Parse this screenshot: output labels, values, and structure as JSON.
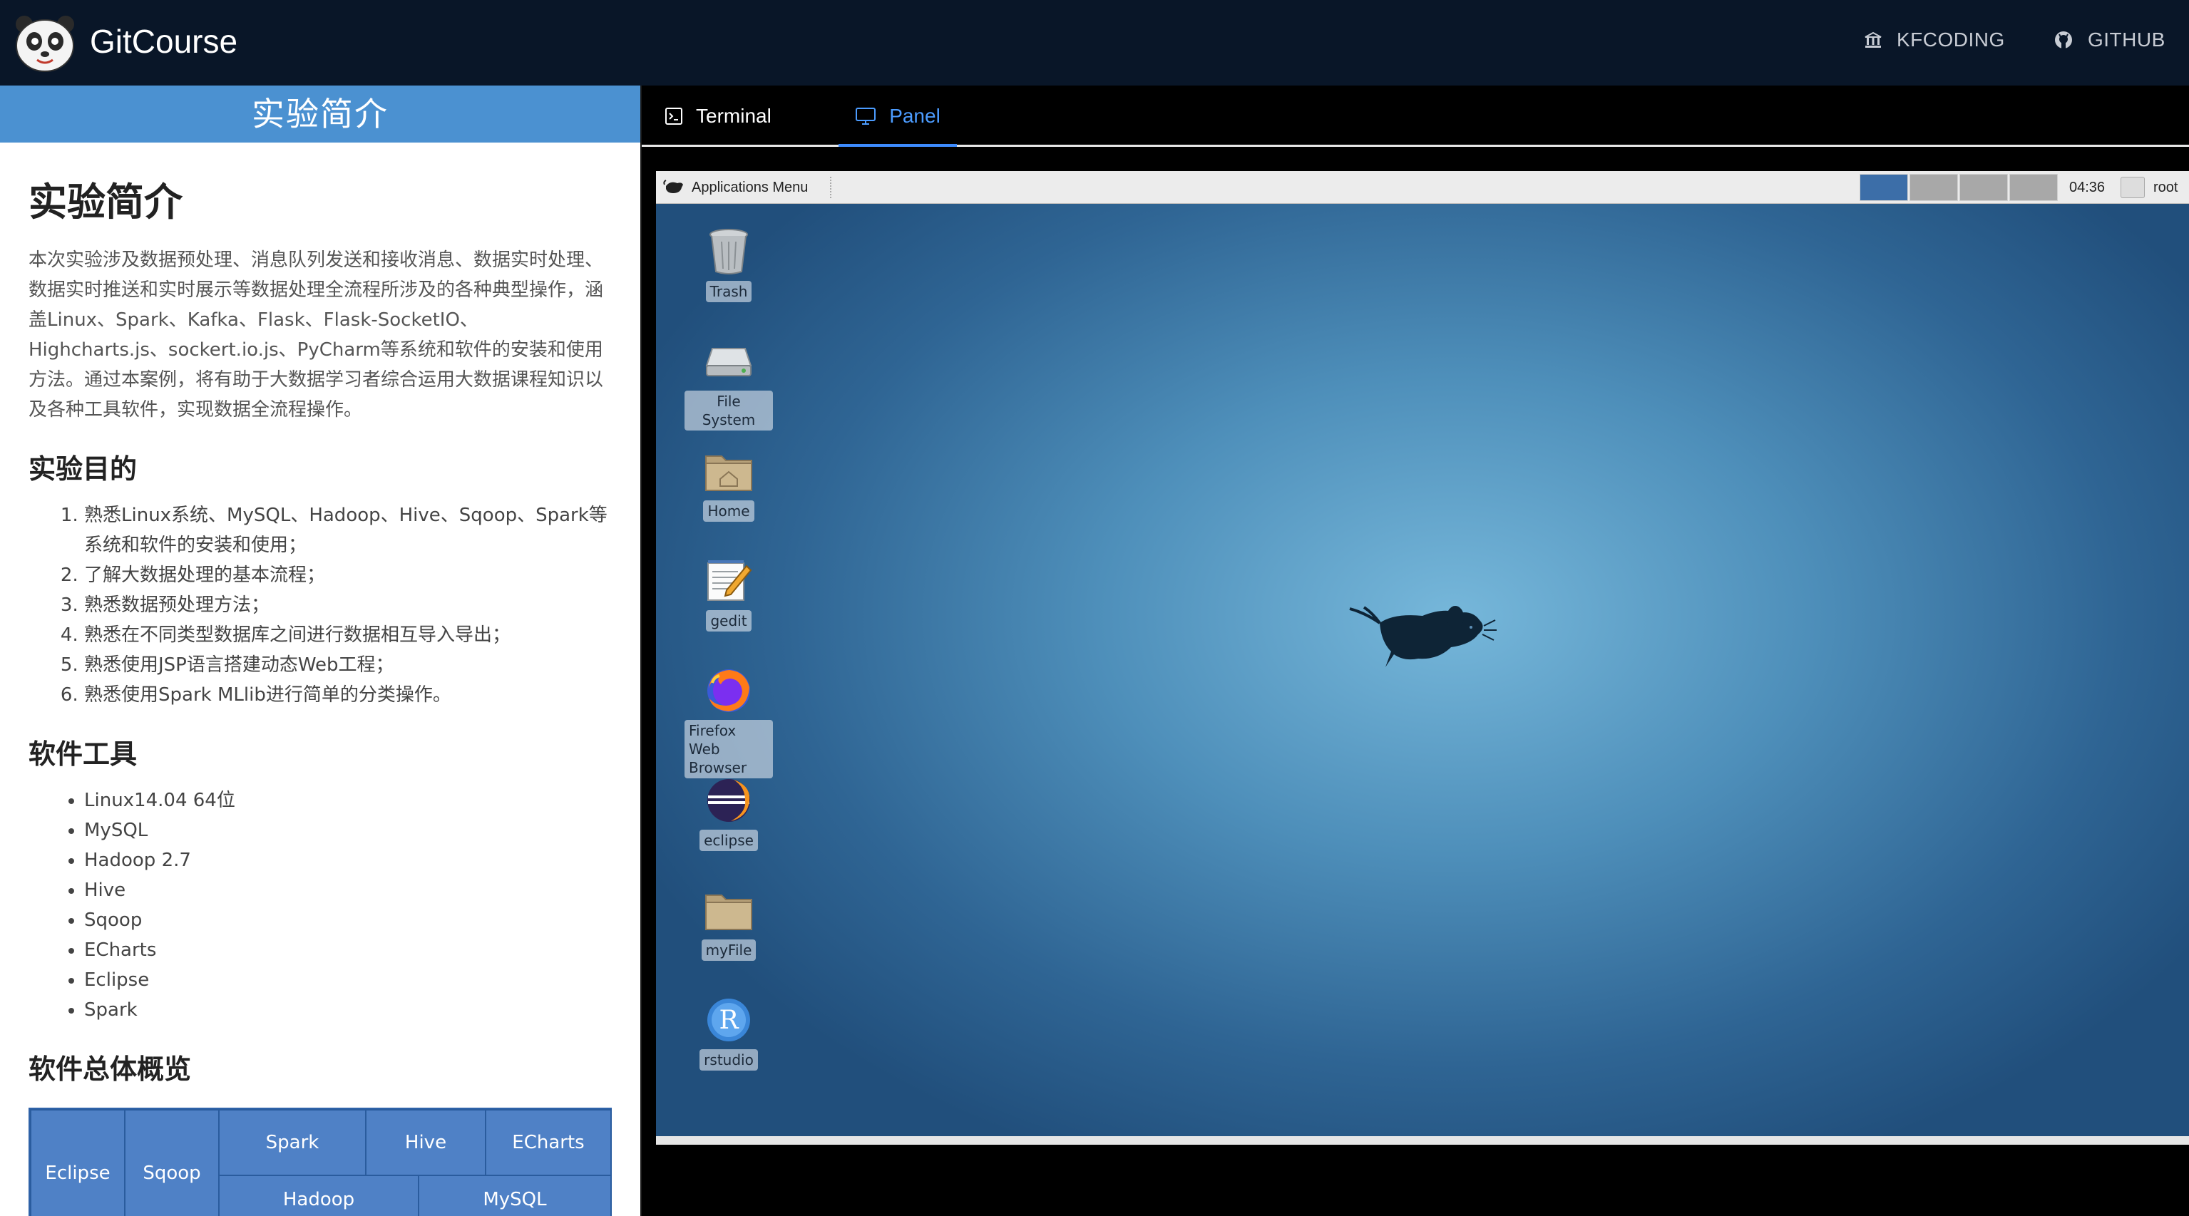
{
  "topbar": {
    "brand": "GitCourse",
    "links": [
      {
        "label": "KFCODING",
        "icon": "bank-icon"
      },
      {
        "label": "GITHUB",
        "icon": "github-icon"
      }
    ]
  },
  "doc": {
    "header": "实验简介",
    "title": "实验简介",
    "intro": "本次实验涉及数据预处理、消息队列发送和接收消息、数据实时处理、数据实时推送和实时展示等数据处理全流程所涉及的各种典型操作，涵盖Linux、Spark、Kafka、Flask、Flask-SocketIO、Highcharts.js、sockert.io.js、PyCharm等系统和软件的安装和使用方法。通过本案例，将有助于大数据学习者综合运用大数据课程知识以及各种工具软件，实现数据全流程操作。",
    "goals_title": "实验目的",
    "goals": [
      "熟悉Linux系统、MySQL、Hadoop、Hive、Sqoop、Spark等系统和软件的安装和使用；",
      "了解大数据处理的基本流程；",
      "熟悉数据预处理方法；",
      "熟悉在不同类型数据库之间进行数据相互导入导出；",
      "熟悉使用JSP语言搭建动态Web工程；",
      "熟悉使用Spark MLlib进行简单的分类操作。"
    ],
    "tools_title": "软件工具",
    "tools": [
      "Linux14.04 64位",
      "MySQL",
      "Hadoop 2.7",
      "Hive",
      "Sqoop",
      "ECharts",
      "Eclipse",
      "Spark"
    ],
    "overview_title": "软件总体概览",
    "arch": {
      "eclipse": "Eclipse",
      "sqoop": "Sqoop",
      "spark": "Spark",
      "hive": "Hive",
      "echarts": "ECharts",
      "hadoop": "Hadoop",
      "mysql": "MySQL"
    }
  },
  "tabs": {
    "terminal": "Terminal",
    "panel": "Panel"
  },
  "desktop": {
    "apps_menu": "Applications Menu",
    "clock": "04:36",
    "user": "root",
    "icons": [
      {
        "label": "Trash",
        "icon": "trash-icon"
      },
      {
        "label": "File System",
        "icon": "drive-icon"
      },
      {
        "label": "Home",
        "icon": "home-folder-icon"
      },
      {
        "label": "gedit",
        "icon": "text-editor-icon"
      },
      {
        "label": "Firefox Web Browser",
        "icon": "firefox-icon"
      },
      {
        "label": "eclipse",
        "icon": "eclipse-icon"
      },
      {
        "label": "myFile",
        "icon": "folder-icon"
      },
      {
        "label": "rstudio",
        "icon": "rstudio-icon"
      }
    ]
  },
  "colors": {
    "navbar": "#091628",
    "doc_header": "#4b91d1",
    "tab_active": "#4c9cff",
    "workspace_active": "#3c6ea8"
  }
}
